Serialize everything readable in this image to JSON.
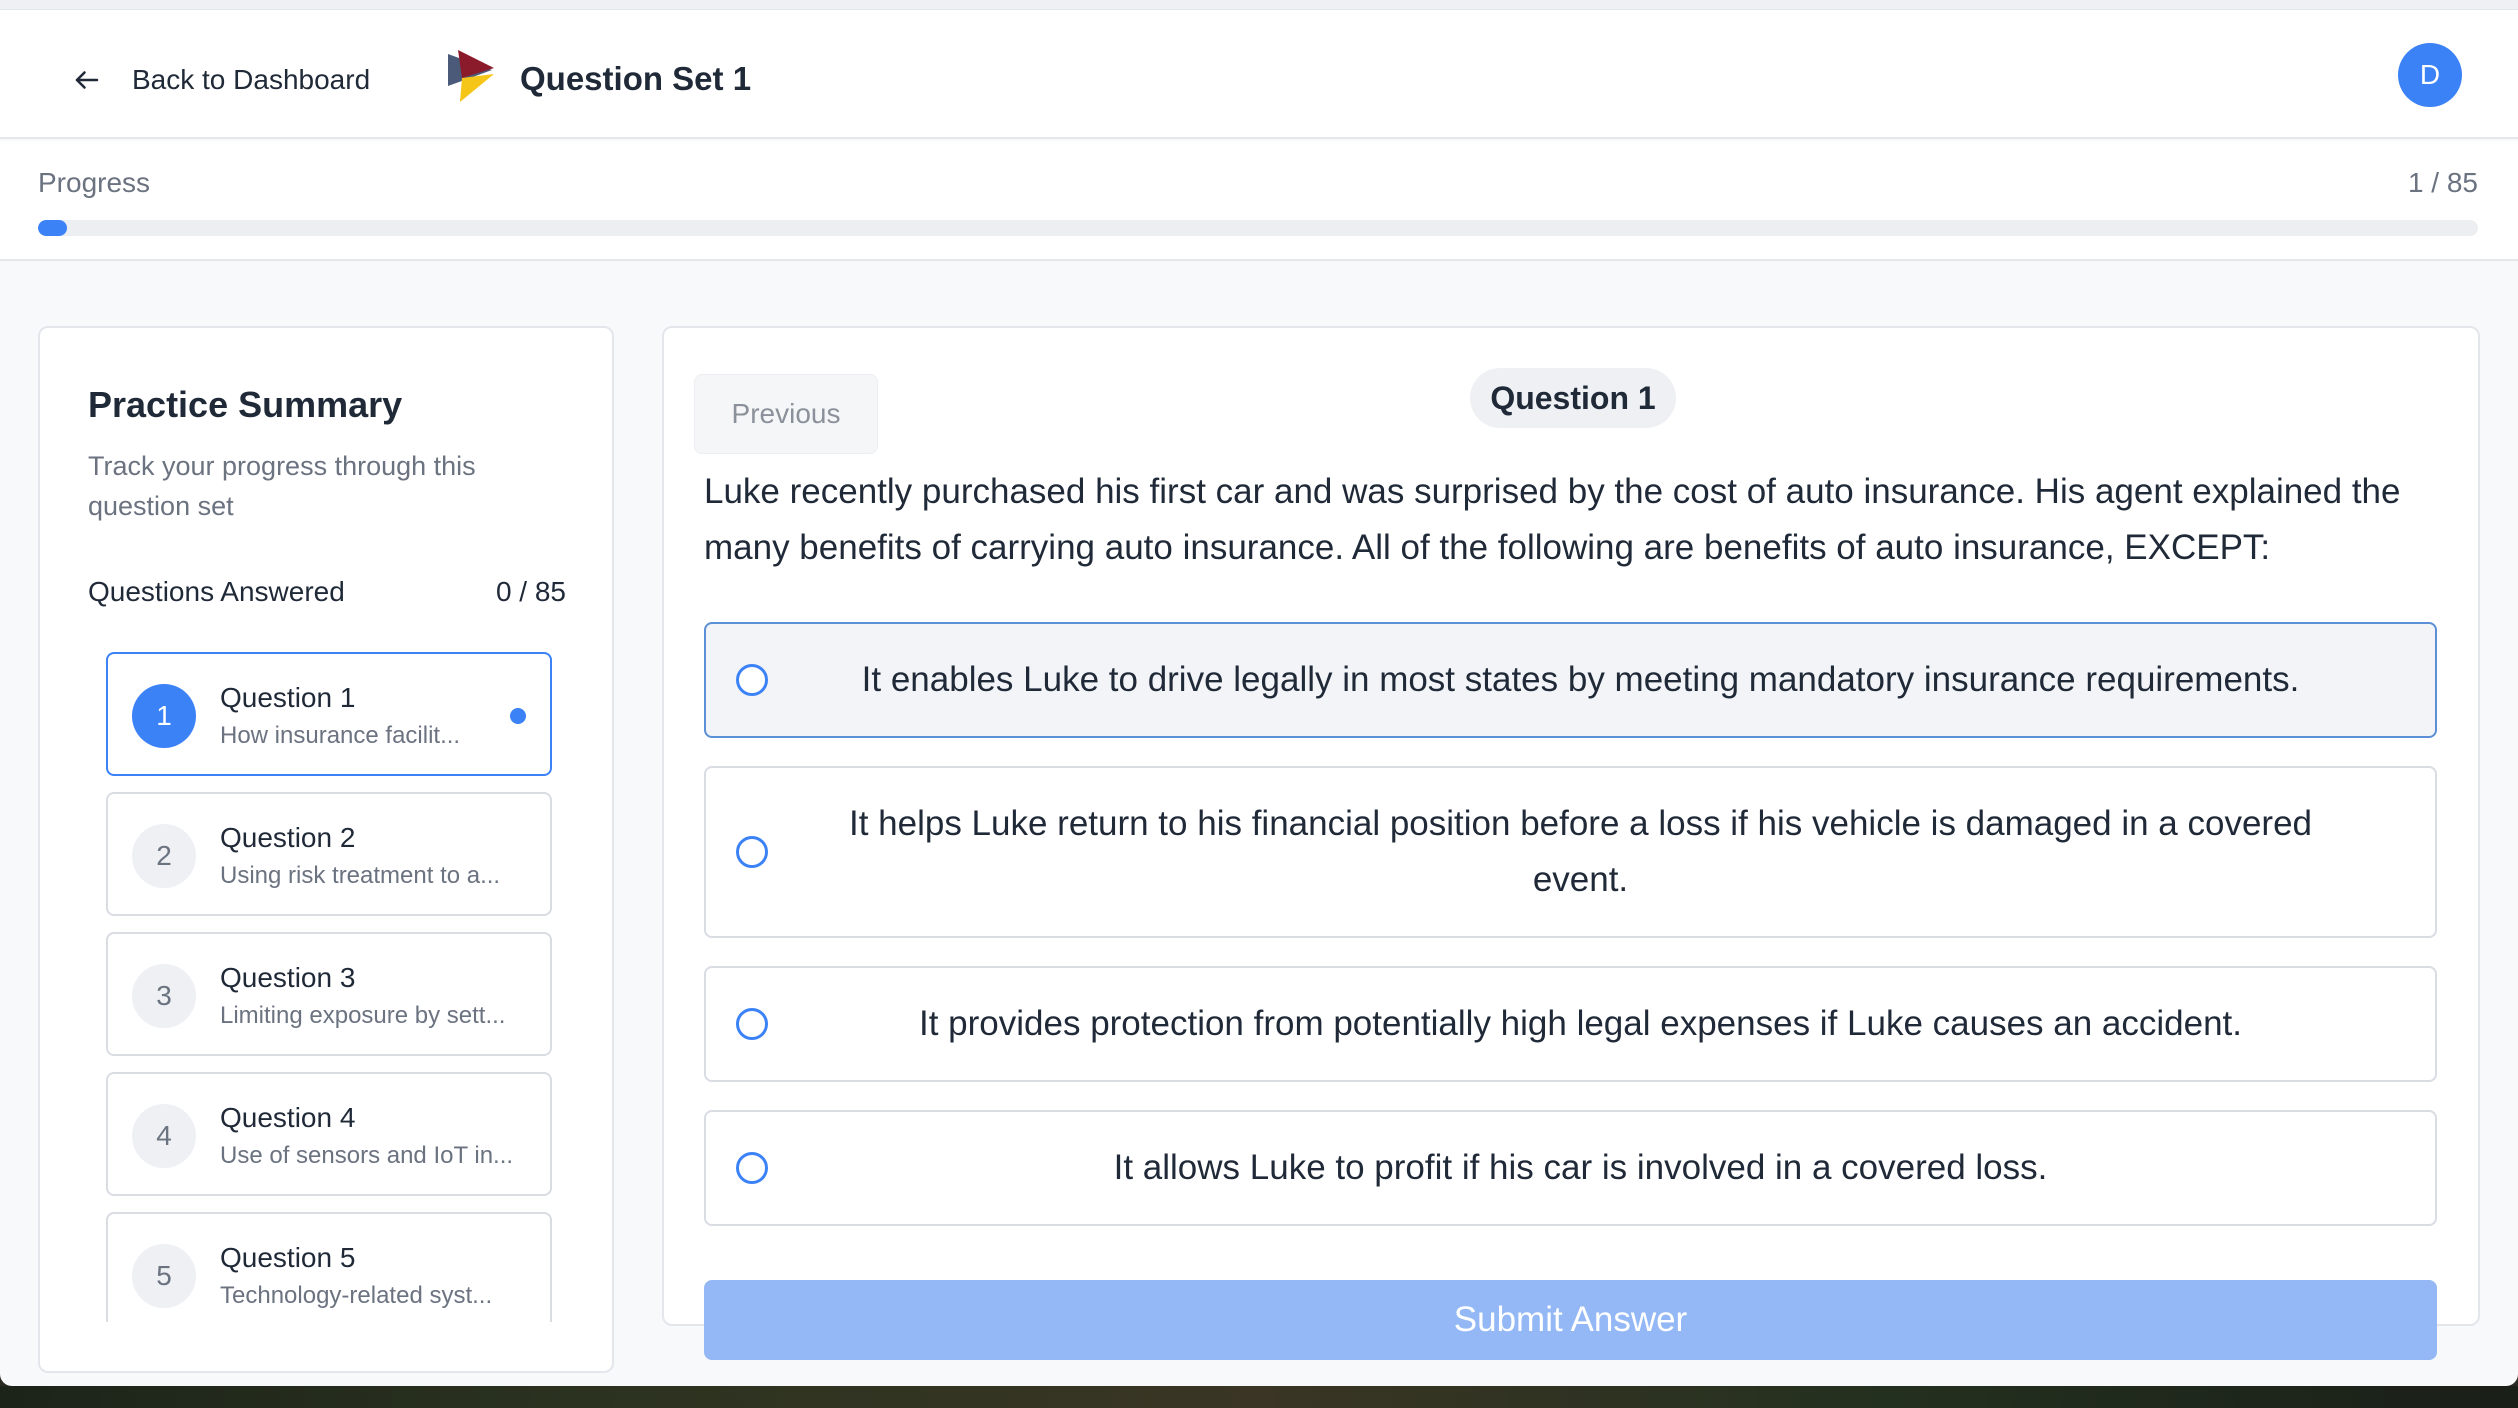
{
  "header": {
    "back_label": "Back to Dashboard",
    "set_title": "Question Set 1",
    "avatar_initial": "D"
  },
  "progress": {
    "label": "Progress",
    "count_text": "1 / 85",
    "current": 1,
    "total": 85
  },
  "sidebar": {
    "title": "Practice Summary",
    "subtitle": "Track your progress through this question set",
    "answered_label": "Questions Answered",
    "answered_count": "0 / 85",
    "questions": [
      {
        "num": "1",
        "title": "Question 1",
        "snippet": "How insurance facilit...",
        "active": true
      },
      {
        "num": "2",
        "title": "Question 2",
        "snippet": "Using risk treatment to a...",
        "active": false
      },
      {
        "num": "3",
        "title": "Question 3",
        "snippet": "Limiting exposure by sett...",
        "active": false
      },
      {
        "num": "4",
        "title": "Question 4",
        "snippet": "Use of sensors and IoT in...",
        "active": false
      },
      {
        "num": "5",
        "title": "Question 5",
        "snippet": "Technology-related syst...",
        "active": false
      }
    ]
  },
  "main": {
    "previous_label": "Previous",
    "question_badge": "Question 1",
    "question_text": "Luke recently purchased his first car and was surprised by the cost of auto insurance. His agent explained the many benefits of carrying auto insurance. All of the following are benefits of auto insurance, EXCEPT:",
    "options": [
      "It enables Luke to drive legally in most states by meeting mandatory insurance requirements.",
      "It helps Luke return to his financial position before a loss if his vehicle is damaged in a covered event.",
      "It provides protection from potentially high legal expenses if Luke causes an accident.",
      "It allows Luke to profit if his car is involved in a covered loss."
    ],
    "submit_label": "Submit Answer"
  },
  "colors": {
    "accent": "#3b82f6",
    "submit_disabled": "#93b8f5",
    "logo_red": "#8b1a2b",
    "logo_yellow": "#f5c518",
    "logo_slate": "#4b5a78"
  }
}
